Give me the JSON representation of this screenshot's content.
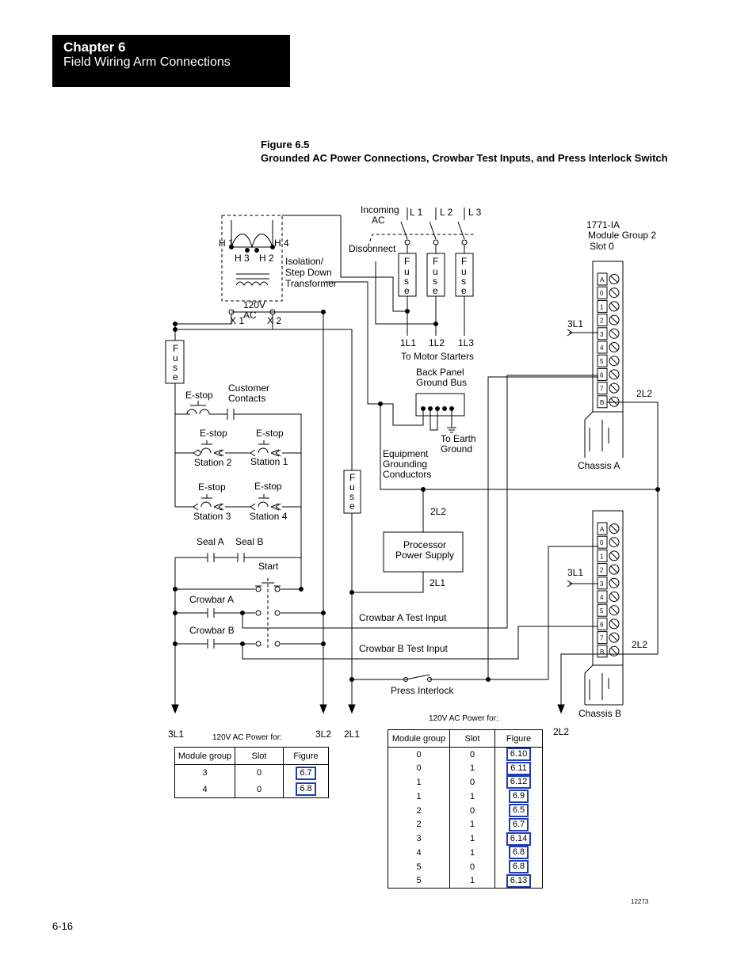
{
  "header": {
    "chapter": "Chapter 6",
    "section": "Field Wiring Arm Connections"
  },
  "figure": {
    "number": "Figure 6.5",
    "title": "Grounded AC Power Connections, Crowbar Test Inputs, and Press Interlock Switch",
    "id": "12273"
  },
  "page_number": "6-16",
  "labels": {
    "incoming_ac_1": "Incoming",
    "incoming_ac_2": "AC",
    "l1": "L 1",
    "l2": "L 2",
    "l3": "L 3",
    "disconnect": "Disconnect",
    "fuse": [
      "F",
      "u",
      "s",
      "e"
    ],
    "h1": "H 1",
    "h4": "H 4",
    "h3": "H 3",
    "h2": "H 2",
    "transformer_1": "Isolation/",
    "transformer_2": "Step Down",
    "transformer_3": "Transformer",
    "v120_1": "120V",
    "v120_2": "AC",
    "x1": "X 1",
    "x2": "X 2",
    "ol1": "1L1",
    "ol2": "1L2",
    "ol3": "1L3",
    "to_motor": "To Motor Starters",
    "back_panel_1": "Back Panel",
    "back_panel_2": "Ground Bus",
    "to_earth_1": "To Earth",
    "to_earth_2": "Ground",
    "equip_1": "Equipment",
    "equip_2": "Grounding",
    "equip_3": "Conductors",
    "estop": "E-stop",
    "customer_1": "Customer",
    "customer_2": "Contacts",
    "station1": "Station 1",
    "station2": "Station 2",
    "station3": "Station 3",
    "station4": "Station 4",
    "seal_a": "Seal A",
    "seal_b": "Seal B",
    "start": "Start",
    "crowbar_a": "Crowbar A",
    "crowbar_b": "Crowbar B",
    "crowbar_a_test": "Crowbar A Test Input",
    "crowbar_b_test": "Crowbar B Test Input",
    "press_interlock": "Press Interlock",
    "proc_ps_1": "Processor",
    "proc_ps_2": "Power Supply",
    "two_l2": "2L2",
    "two_l1": "2L1",
    "three_l1": "3L1",
    "three_l2": "3L2",
    "module_1": "1771-IA",
    "module_2": "Module Group 2",
    "module_3": "Slot 0",
    "chassis_a": "Chassis A",
    "chassis_b": "Chassis B",
    "terminals": [
      "A",
      "0",
      "1",
      "2",
      "3",
      "4",
      "5",
      "6",
      "7",
      "B"
    ]
  },
  "table_small": {
    "caption": "120V AC Power for:",
    "headers": [
      "Module group",
      "Slot",
      "Figure"
    ],
    "rows": [
      [
        "3",
        "0",
        "6.7"
      ],
      [
        "4",
        "0",
        "6.8"
      ]
    ]
  },
  "table_large": {
    "caption": "120V AC Power for:",
    "headers": [
      "Module group",
      "Slot",
      "Figure"
    ],
    "rows": [
      [
        "0",
        "0",
        "6.10"
      ],
      [
        "0",
        "1",
        "6.11"
      ],
      [
        "1",
        "0",
        "6.12"
      ],
      [
        "1",
        "1",
        "6.9"
      ],
      [
        "2",
        "0",
        "6.5"
      ],
      [
        "2",
        "1",
        "6.7"
      ],
      [
        "3",
        "1",
        "6.14"
      ],
      [
        "4",
        "1",
        "6.8"
      ],
      [
        "5",
        "0",
        "6.8"
      ],
      [
        "5",
        "1",
        "6.13"
      ]
    ]
  },
  "colors": {
    "figure_link_border": "#1f3cb5"
  }
}
